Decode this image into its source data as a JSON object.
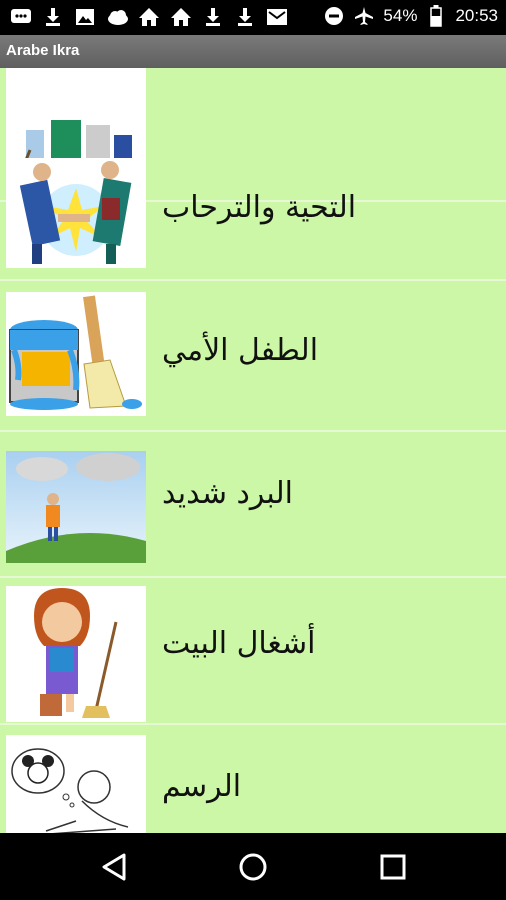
{
  "status_bar": {
    "battery": "54%",
    "time": "20:53",
    "left_icons": [
      "chat-icon",
      "download-icon",
      "image-icon",
      "cloud-icon",
      "home-icon",
      "home-icon",
      "download-icon",
      "download-icon",
      "mail-icon"
    ],
    "right_icons": [
      "do-not-disturb-icon",
      "airplane-icon",
      "battery-icon"
    ]
  },
  "app": {
    "title": "Arabe Ikra"
  },
  "list": {
    "items": [
      {
        "label": "",
        "image": "people-family-image"
      },
      {
        "label": "التحية والترحاب",
        "image": "handshake-image"
      },
      {
        "label": "الطفل الأمي",
        "image": "paint-bucket-image"
      },
      {
        "label": "البرد شديد",
        "image": "cold-weather-image"
      },
      {
        "label": "أشغال البيت",
        "image": "girl-broom-image"
      },
      {
        "label": "الرسم",
        "image": "drawing-boy-image"
      }
    ]
  },
  "nav": {
    "buttons": [
      "back-icon",
      "home-icon",
      "recents-icon"
    ]
  }
}
